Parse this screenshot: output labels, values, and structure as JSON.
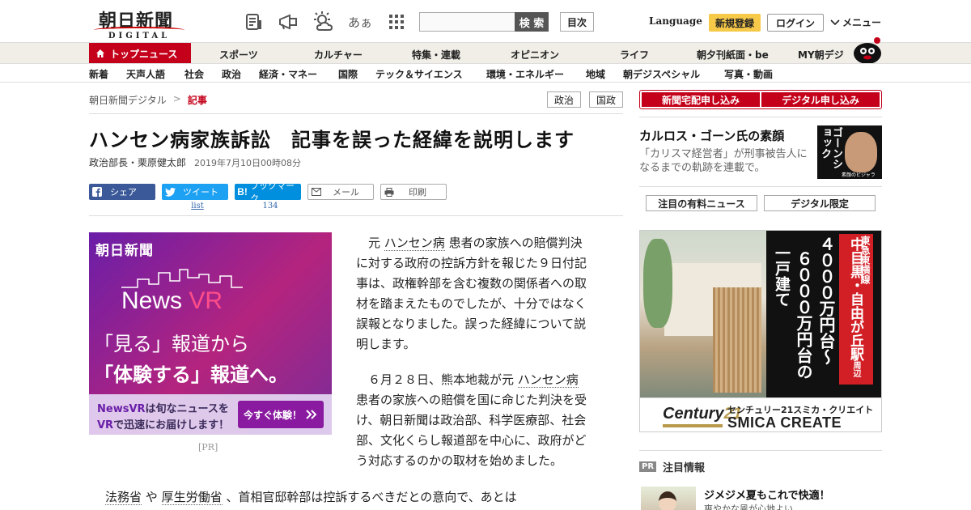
{
  "header": {
    "logo_jp": "朝日新聞",
    "logo_en": "DIGITAL",
    "search_placeholder": "",
    "search_button": "検 索",
    "toc_button": "目次",
    "language": "Language",
    "signup": "新規登録",
    "login": "ログイン",
    "menu": "メニュー",
    "icons": [
      "paper-icon",
      "megaphone-icon",
      "weather-icon",
      "font-size-icon",
      "grid-icon"
    ],
    "font_size_glyph": "あぁ"
  },
  "nav_primary": {
    "top_news": "トップニュース",
    "items": [
      "スポーツ",
      "カルチャー",
      "特集・連載",
      "オピニオン",
      "ライフ",
      "朝夕刊紙面・be",
      "MY朝デジ"
    ]
  },
  "nav_secondary": {
    "items": [
      "新着",
      "天声人語",
      "社会",
      "政治",
      "経済・マネー",
      "国際",
      "テック＆サイエンス",
      "環境・エネルギー",
      "地域",
      "朝デジスペシャル",
      "写真・動画"
    ]
  },
  "breadcrumb": {
    "home": "朝日新聞デジタル",
    "separator": ">",
    "current": "記事"
  },
  "tags": [
    "政治",
    "国政"
  ],
  "article": {
    "title": "ハンセン病家族訴訟　記事を誤った経緯を説明します",
    "author": "政治部長・栗原健太郎",
    "timestamp": "2019年7月10日00時08分",
    "share": {
      "facebook": "シェア",
      "twitter": "ツイート",
      "hatena": "ブックマーク",
      "mail": "メール",
      "print": "印刷",
      "twitter_count": "list",
      "hatena_count": "134"
    },
    "p1_lines": [
      [
        "　元 ",
        "ハンセン病",
        " 患者の家族への賠償判決"
      ],
      [
        "に対する政府の控訴方針を報じた９日付記"
      ],
      [
        "事は、政権幹部を含む複数の関係者への取"
      ],
      [
        "材を踏まえたものでしたが、十分ではなく"
      ],
      [
        "誤報となりました。誤った経緯について説"
      ],
      [
        "明します。"
      ]
    ],
    "p2_lines": [
      [
        "　６月２８日、熊本地裁が元 ",
        "ハンセン病"
      ],
      [
        "患者の家族への賠償を国に命じた判決を受"
      ],
      [
        "け、朝日新聞は政治部、科学医療部、社会"
      ],
      [
        "部、文化くらし報道部を中心に、政府がど"
      ],
      [
        "う対応するのかの取材を始めました。"
      ]
    ],
    "p3_parts": [
      "法務省",
      " や ",
      "厚生労働省",
      " 、首相官邸幹部は控訴するべきだとの意向で、あとは"
    ]
  },
  "ad_vr": {
    "brand": "朝日新聞",
    "title_a": "News ",
    "title_b": "VR",
    "line1": "「見る」報道から",
    "line2": "「体験する」報道へ。",
    "foot1_a": "NewsVR",
    "foot1_b": "は旬なニュースを",
    "foot2_a": "VR",
    "foot2_b": "で迅速にお届けします！",
    "cta": "今すぐ体験！",
    "pr_label": "[PR]"
  },
  "sidebar": {
    "subscribe_paper": "新聞宅配申し込み",
    "subscribe_digital": "デジタル申し込み",
    "feature_title": "カルロス・ゴーン氏の素顔",
    "feature_desc": "「カリスマ経営者」が刑事被告人になるまでの軌跡を連載で。",
    "feature_img_text": "ゴーンショック",
    "feature_img_caption": "素顔のビジャラ",
    "tab_paid": "注目の有料ニュース",
    "tab_digital": "デジタル限定",
    "pr_badge": "PR",
    "pr_heading": "注目情報",
    "pick_title": "ジメジメ夏もこれで快適！",
    "pick_sub": "爽やかな風が心地よい"
  },
  "ad_realestate": {
    "col1": "東急東横線",
    "col2": "中目黒・自由が丘駅",
    "col2_small": "周辺",
    "col3": "４０００万円台～",
    "col4": "６０００万円台の",
    "col5": "一戸建て",
    "logo_a": "Century",
    "logo_b": "21",
    "company_jp": "センチュリー21スミカ・クリエイト",
    "company_en": "SMICA CREATE"
  },
  "colors": {
    "brand_red": "#c4001a",
    "signup_yellow": "#f7c948",
    "facebook": "#3b5998",
    "twitter": "#1da1f2",
    "hatena": "#008fde"
  }
}
